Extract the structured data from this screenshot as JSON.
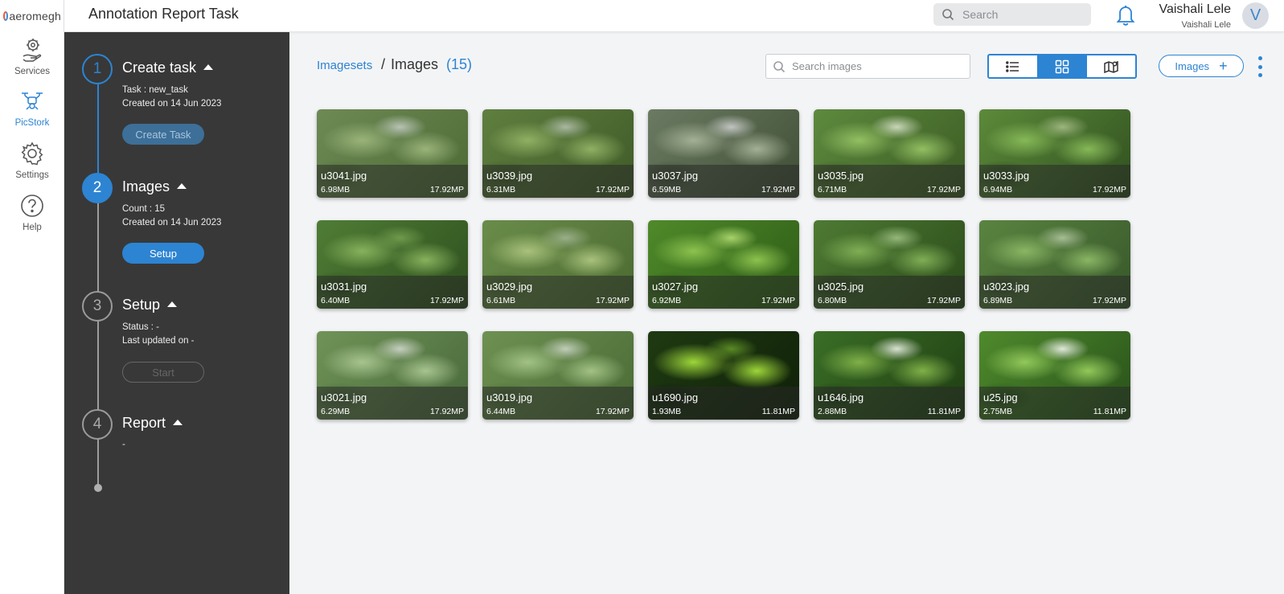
{
  "brand": {
    "name": "aeromegh"
  },
  "rail": {
    "items": [
      {
        "label": "Services",
        "icon": "services-hand-gear-icon"
      },
      {
        "label": "PicStork",
        "icon": "drone-icon",
        "active": true
      },
      {
        "label": "Settings",
        "icon": "gear-icon"
      },
      {
        "label": "Help",
        "icon": "question-circle-icon"
      }
    ]
  },
  "header": {
    "title": "Annotation Report Task",
    "search_placeholder": "Search",
    "user_name": "Vaishali Lele",
    "user_sub": "Vaishali Lele",
    "avatar_initial": "V"
  },
  "workflow": {
    "steps": [
      {
        "num": "1",
        "title": "Create task",
        "lines": [
          "Task : new_task",
          "Created on 14 Jun 2023"
        ],
        "button": "Create Task"
      },
      {
        "num": "2",
        "title": "Images",
        "lines": [
          "Count : 15",
          "Created on 14 Jun 2023"
        ],
        "button": "Setup"
      },
      {
        "num": "3",
        "title": "Setup",
        "lines": [
          "Status : -",
          "Last updated on -"
        ],
        "button": "Start"
      },
      {
        "num": "4",
        "title": "Report",
        "lines": [
          "-"
        ]
      }
    ]
  },
  "main": {
    "breadcrumb_link": "Imagesets",
    "breadcrumb_sep": "/",
    "breadcrumb_current": "Images",
    "count": "(15)",
    "search_placeholder": "Search images",
    "add_label": "Images",
    "add_symbol": "+",
    "accent": "#2d84d2"
  },
  "images": [
    {
      "name": "u3041.jpg",
      "size": "6.98MB",
      "mp": "17.92MP"
    },
    {
      "name": "u3039.jpg",
      "size": "6.31MB",
      "mp": "17.92MP"
    },
    {
      "name": "u3037.jpg",
      "size": "6.59MB",
      "mp": "17.92MP"
    },
    {
      "name": "u3035.jpg",
      "size": "6.71MB",
      "mp": "17.92MP"
    },
    {
      "name": "u3033.jpg",
      "size": "6.94MB",
      "mp": "17.92MP"
    },
    {
      "name": "u3031.jpg",
      "size": "6.40MB",
      "mp": "17.92MP"
    },
    {
      "name": "u3029.jpg",
      "size": "6.61MB",
      "mp": "17.92MP"
    },
    {
      "name": "u3027.jpg",
      "size": "6.92MB",
      "mp": "17.92MP"
    },
    {
      "name": "u3025.jpg",
      "size": "6.80MB",
      "mp": "17.92MP"
    },
    {
      "name": "u3023.jpg",
      "size": "6.89MB",
      "mp": "17.92MP"
    },
    {
      "name": "u3021.jpg",
      "size": "6.29MB",
      "mp": "17.92MP"
    },
    {
      "name": "u3019.jpg",
      "size": "6.44MB",
      "mp": "17.92MP"
    },
    {
      "name": "u1690.jpg",
      "size": "1.93MB",
      "mp": "11.81MP"
    },
    {
      "name": "u1646.jpg",
      "size": "2.88MB",
      "mp": "11.81MP"
    },
    {
      "name": "u25.jpg",
      "size": "2.75MB",
      "mp": "11.81MP"
    }
  ]
}
